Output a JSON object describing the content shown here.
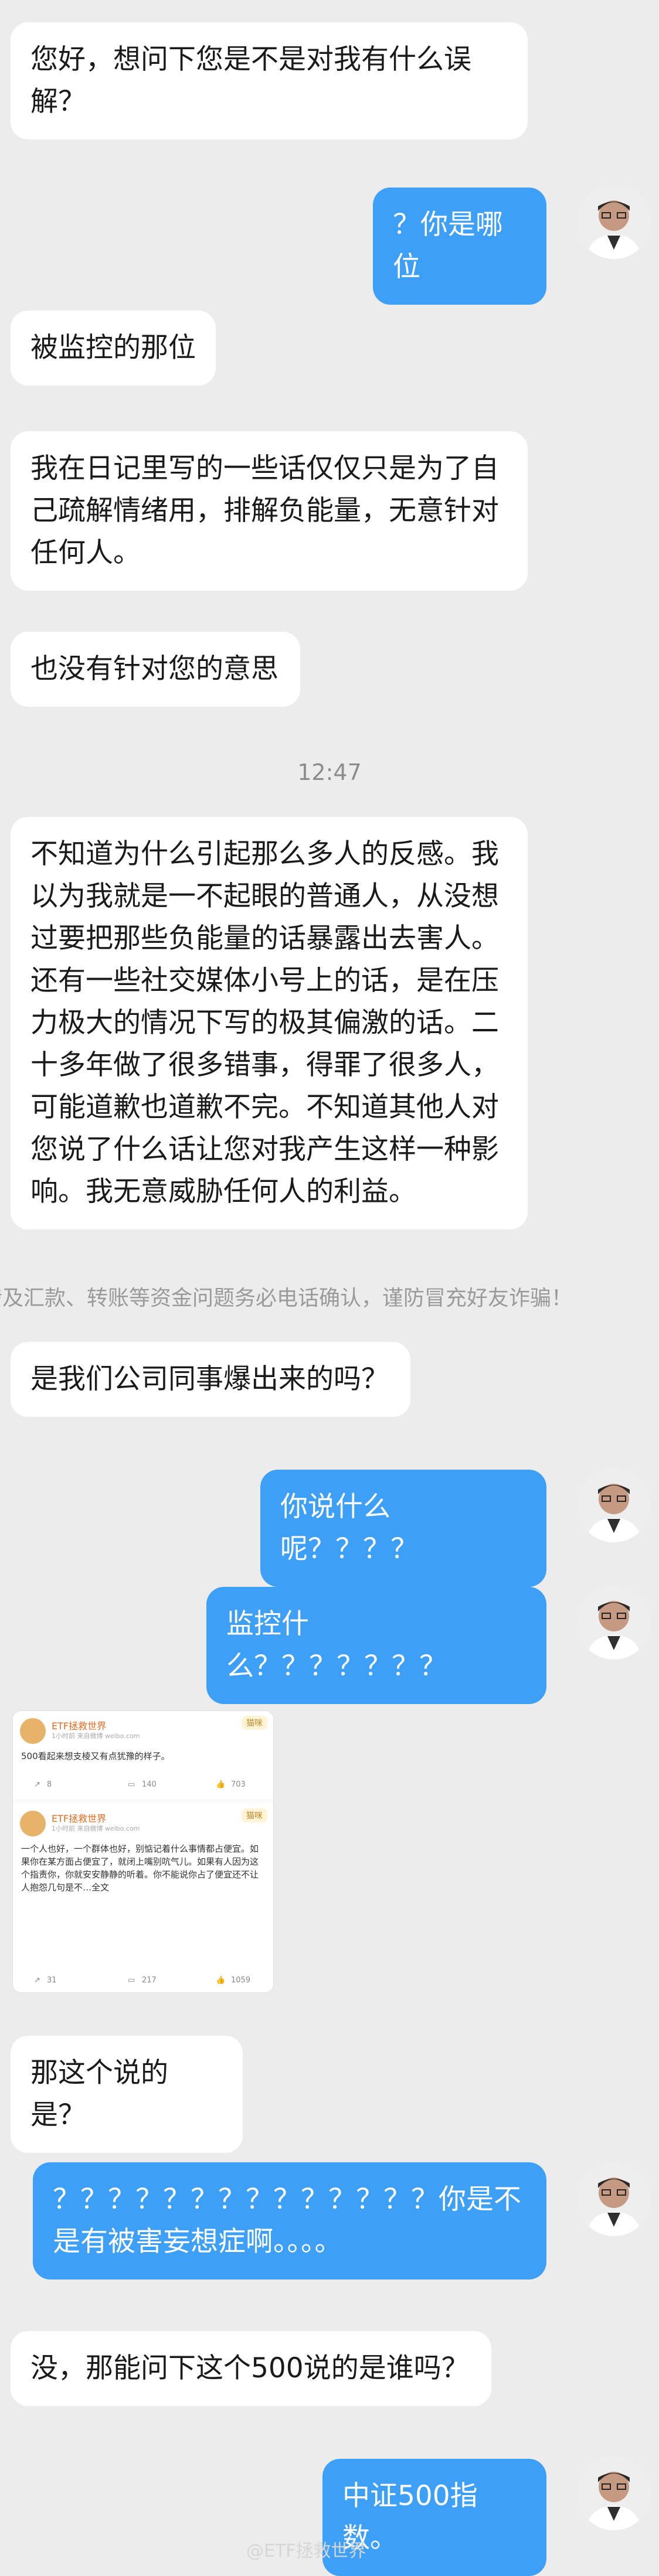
{
  "messages": [
    {
      "side": "left",
      "text": "您好，想问下您是不是对我有什么误解？"
    },
    {
      "side": "right",
      "text": "？你是哪位"
    },
    {
      "side": "left",
      "text": "被监控的那位"
    },
    {
      "side": "left",
      "text": "我在日记里写的一些话仅仅只是为了自己疏解情绪用，排解负能量，无意针对任何人。"
    },
    {
      "side": "left",
      "text": "也没有针对您的意思"
    },
    {
      "side": "left",
      "text": "不知道为什么引起那么多人的反感。我以为我就是一不起眼的普通人，从没想过要把那些负能量的话暴露出去害人。还有一些社交媒体小号上的话，是在压力极大的情况下写的极其偏激的话。二十多年做了很多错事，得罪了很多人，可能道歉也道歉不完。不知道其他人对您说了什么话让您对我产生这样一种影响。我无意威胁任何人的利益。"
    },
    {
      "side": "left",
      "text": "是我们公司同事爆出来的吗？"
    },
    {
      "side": "right",
      "text": "你说什么呢？？？？"
    },
    {
      "side": "right",
      "text": "监控什么？？？？？？？"
    },
    {
      "side": "left",
      "text": "那这个说的是？"
    },
    {
      "side": "right",
      "text": "？？？？？？？？？？？？？？你是不是有被害妄想症啊。。。。"
    },
    {
      "side": "left",
      "text": "没，那能问下这个500说的是谁吗？"
    },
    {
      "side": "right",
      "text": "中证500指数。"
    }
  ],
  "timestamp": "12:47",
  "notice": "涉及汇款、转账等资金问题务必电话确认，谨防冒充好友诈骗！",
  "screenshot_posts": [
    {
      "name": "ETF拯救世界",
      "meta": "1小时前  来自微博 weibo.com",
      "badge": "猫咪",
      "text": "500看起来想支棱又有点犹豫的样子。",
      "reposts": "8",
      "comments": "140",
      "likes": "703"
    },
    {
      "name": "ETF拯救世界",
      "meta": "1小时前  来自微博 weibo.com",
      "badge": "猫咪",
      "text": "一个人也好，一个群体也好，别惦记着什么事情都占便宜。如果你在某方面占便宜了，就闭上嘴别吭气儿。如果有人因为这个指责你，你就安安静静的听着。你不能说你占了便宜还不让人抱怨几句是不…全文",
      "reposts": "31",
      "comments": "217",
      "likes": "1059"
    }
  ],
  "watermark": "@ETF拯救世界",
  "colors": {
    "background": "#ececec",
    "left_bubble": "#ffffff",
    "right_bubble": "#3d9ff5"
  },
  "icons": {
    "repost": "repost-icon",
    "comment": "comment-icon",
    "like": "like-icon"
  }
}
